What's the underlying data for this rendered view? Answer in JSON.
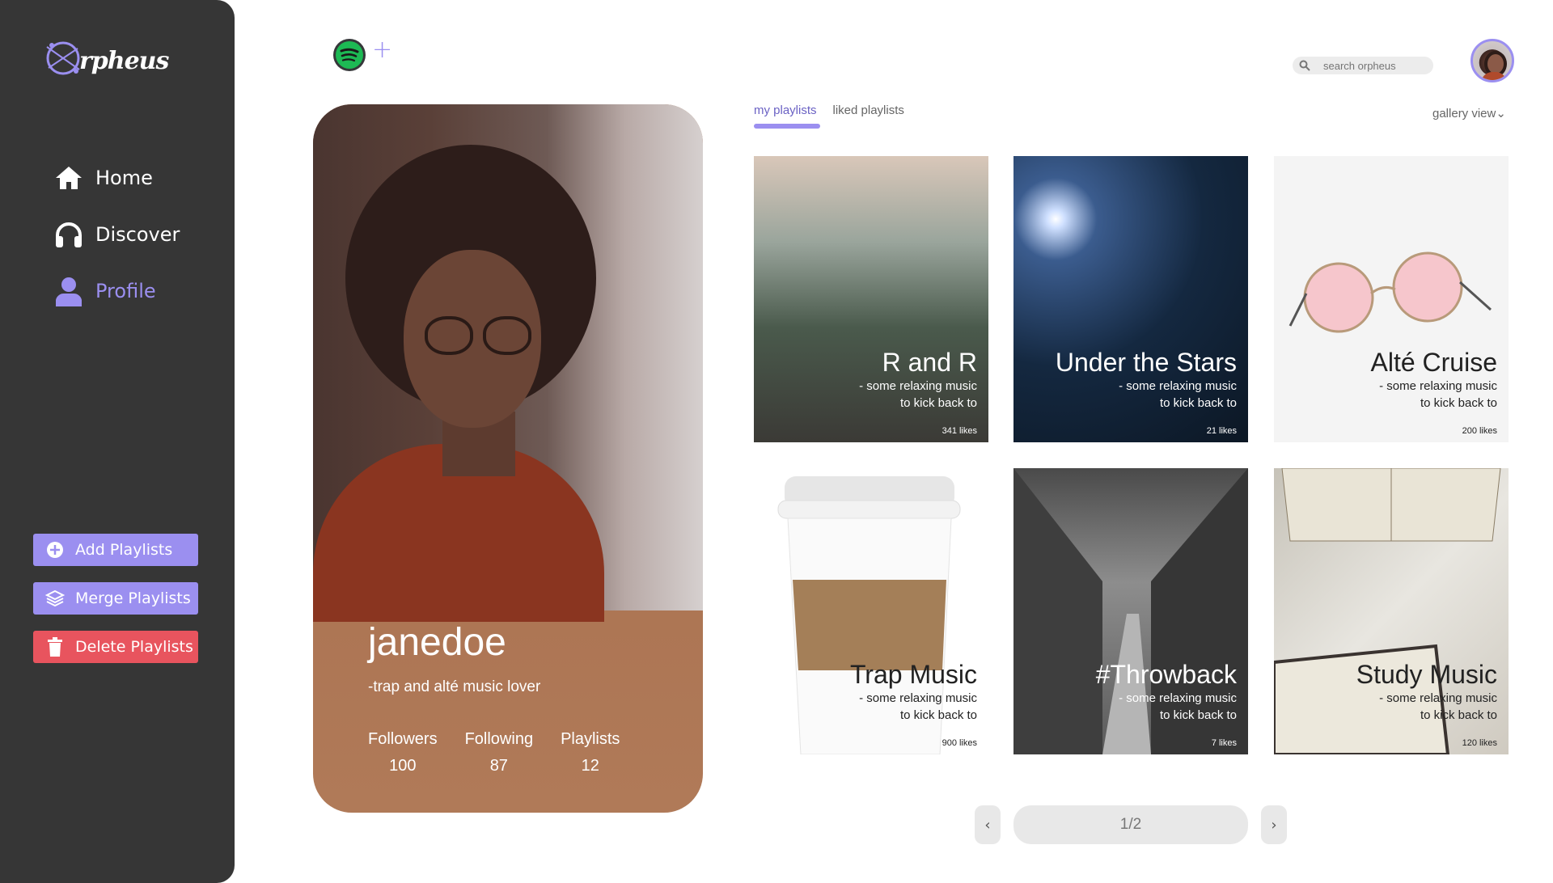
{
  "app": {
    "logo_text": "rpheus"
  },
  "sidebar": {
    "nav": [
      {
        "label": "Home",
        "icon": "home-icon"
      },
      {
        "label": "Discover",
        "icon": "headphones-icon"
      },
      {
        "label": "Profile",
        "icon": "user-icon",
        "active": true
      }
    ],
    "buttons": {
      "add": "Add Playlists",
      "merge": "Merge Playlists",
      "delete": "Delete Playlists"
    }
  },
  "header": {
    "search_placeholder": "search orpheus",
    "plus": "+"
  },
  "profile": {
    "username": "janedoe",
    "bio": "-trap and alté music lover",
    "stats": [
      {
        "label": "Followers",
        "value": "100"
      },
      {
        "label": "Following",
        "value": "87"
      },
      {
        "label": "Playlists",
        "value": "12"
      }
    ]
  },
  "tabs": [
    {
      "label": "my playlists",
      "active": true
    },
    {
      "label": "liked playlists",
      "active": false
    }
  ],
  "view_select": "gallery view",
  "playlists": [
    {
      "title": "R and R",
      "desc1": "- some relaxing music",
      "desc2": "to kick back to",
      "likes": "341 likes"
    },
    {
      "title": "Under the Stars",
      "desc1": "- some relaxing music",
      "desc2": "to kick back to",
      "likes": "21 likes"
    },
    {
      "title": "Alté Cruise",
      "desc1": "- some relaxing music",
      "desc2": "to kick back to",
      "likes": "200 likes"
    },
    {
      "title": "Trap Music",
      "desc1": "- some relaxing music",
      "desc2": "to kick back to",
      "likes": "900 likes"
    },
    {
      "title": "#Throwback",
      "desc1": "- some relaxing music",
      "desc2": "to kick back to",
      "likes": "7 likes"
    },
    {
      "title": "Study Music",
      "desc1": "- some relaxing music",
      "desc2": "to kick back to",
      "likes": "120 likes"
    }
  ],
  "pagination": {
    "label": "1/2",
    "prev": "‹",
    "next": "›"
  },
  "colors": {
    "accent": "#9b8ff0",
    "danger": "#e8545e",
    "sidebar": "#363636"
  }
}
